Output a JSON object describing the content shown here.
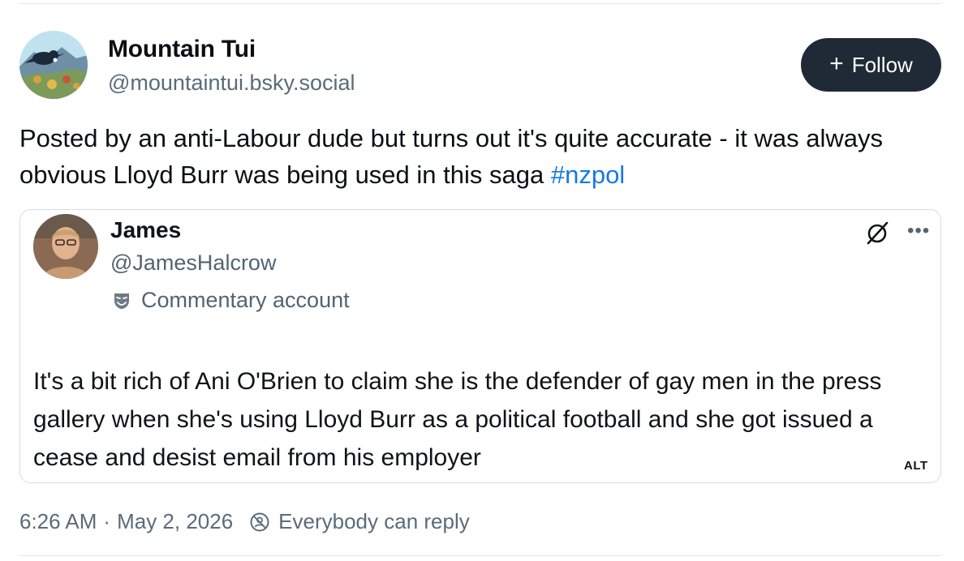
{
  "author": {
    "name": "Mountain Tui",
    "handle": "@mountaintui.bsky.social"
  },
  "follow_button": {
    "icon": "plus-icon",
    "label": "Follow"
  },
  "post": {
    "text": "Posted by an anti-Labour dude but turns out it's quite accurate - it was always obvious Lloyd Burr was being used in this saga ",
    "hashtag": "#nzpol"
  },
  "embed": {
    "name": "James",
    "handle": "@JamesHalcrow",
    "badge": "Commentary account",
    "badge_icon": "theater-mask-icon",
    "logo_icon": "x-logo-icon",
    "more_icon": "more-icon",
    "body": "It's a bit rich of Ani O'Brien to claim she is the defender of gay men in the press gallery when she's using Lloyd Burr as a political football and she got issued a cease and desist email from his employer",
    "alt_label": "ALT"
  },
  "footer": {
    "time": "6:26 AM",
    "separator": "·",
    "date": "May 2, 2026",
    "reply_icon": "reply-settings-icon",
    "reply_setting": "Everybody can reply"
  },
  "colors": {
    "follow_bg": "#1f2a36",
    "hashtag": "#1877e6",
    "muted": "#5b6b7a"
  }
}
